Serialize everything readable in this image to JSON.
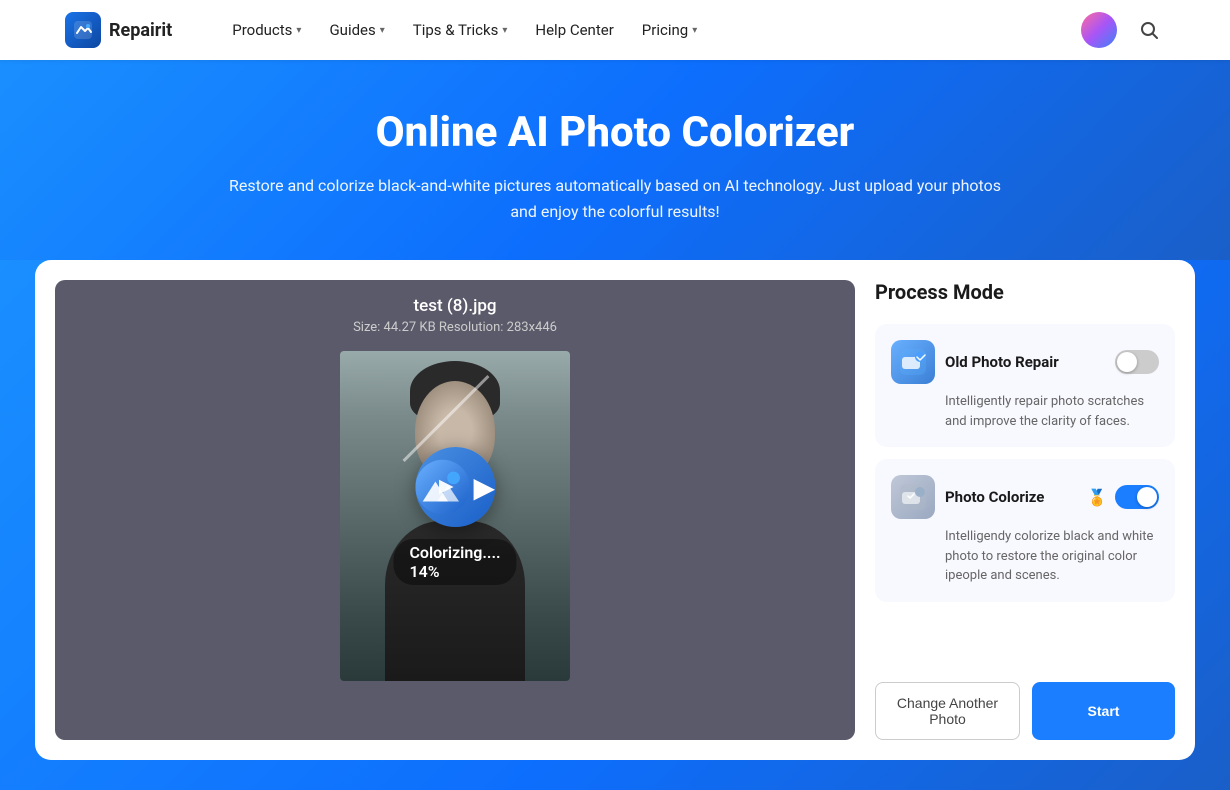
{
  "nav": {
    "logo_text": "Repairit",
    "items": [
      {
        "label": "Products",
        "has_chevron": true
      },
      {
        "label": "Guides",
        "has_chevron": true
      },
      {
        "label": "Tips & Tricks",
        "has_chevron": true
      },
      {
        "label": "Help Center",
        "has_chevron": false
      },
      {
        "label": "Pricing",
        "has_chevron": true
      }
    ]
  },
  "hero": {
    "title": "Online AI Photo Colorizer",
    "subtitle": "Restore and colorize black-and-white pictures automatically based on AI technology. Just upload your photos and enjoy the colorful results!"
  },
  "image_panel": {
    "file_name": "test (8).jpg",
    "file_info": "Size: 44.27 KB  Resolution: 283x446",
    "progress_text": "Colorizing.... 14%"
  },
  "right_panel": {
    "section_title": "Process Mode",
    "modes": [
      {
        "id": "old-photo-repair",
        "label": "Old Photo Repair",
        "description": "Intelligently repair photo scratches and improve the clarity of faces.",
        "premium": false,
        "enabled": false,
        "icon_type": "repair"
      },
      {
        "id": "photo-colorize",
        "label": "Photo Colorize",
        "description": "Intelligendy colorize black and white photo to restore the original color ipeople and scenes.",
        "premium": true,
        "enabled": true,
        "icon_type": "colorize"
      }
    ],
    "btn_change": "Change Another Photo",
    "btn_start": "Start"
  }
}
